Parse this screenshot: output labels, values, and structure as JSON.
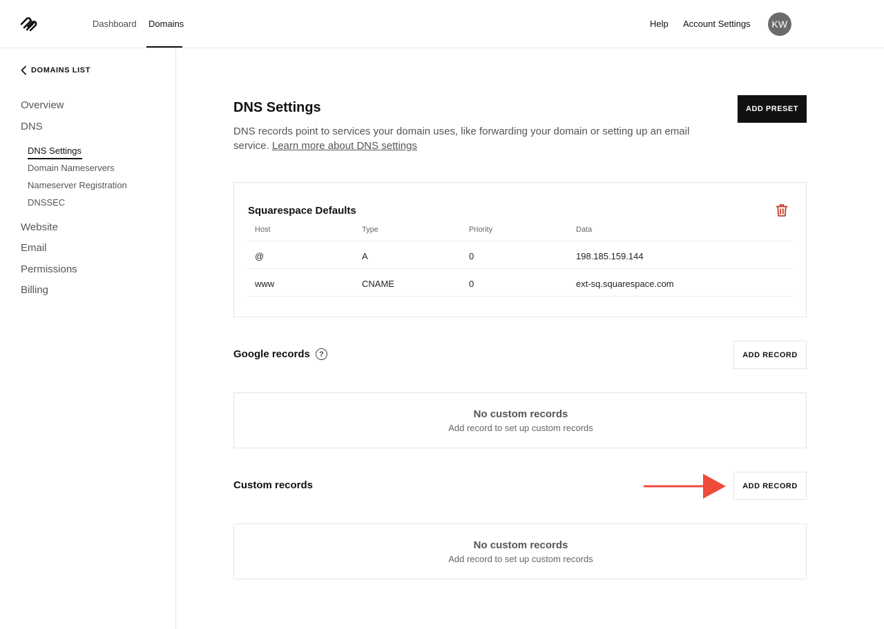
{
  "topbar": {
    "nav": [
      {
        "label": "Dashboard"
      },
      {
        "label": "Domains"
      }
    ],
    "help_label": "Help",
    "account_label": "Account Settings",
    "avatar_initials": "KW"
  },
  "sidebar": {
    "back_label": "DOMAINS LIST",
    "main": [
      {
        "label": "Overview"
      },
      {
        "label": "DNS"
      },
      {
        "label": "Website"
      },
      {
        "label": "Email"
      },
      {
        "label": "Permissions"
      },
      {
        "label": "Billing"
      }
    ],
    "sub": [
      {
        "label": "DNS Settings"
      },
      {
        "label": "Domain Nameservers"
      },
      {
        "label": "Nameserver Registration"
      },
      {
        "label": "DNSSEC"
      }
    ]
  },
  "main": {
    "title": "DNS Settings",
    "description": "DNS records point to services your domain uses, like forwarding your domain or setting up an email service.",
    "learn_more": "Learn more about DNS settings",
    "add_preset": "ADD PRESET",
    "defaults": {
      "title": "Squarespace Defaults",
      "columns": [
        "Host",
        "Type",
        "Priority",
        "Data"
      ],
      "rows": [
        [
          "@",
          "A",
          "0",
          "198.185.159.144"
        ],
        [
          "www",
          "CNAME",
          "0",
          "ext-sq.squarespace.com"
        ]
      ]
    },
    "google": {
      "title": "Google records",
      "help_glyph": "?",
      "add_label": "ADD RECORD",
      "empty_title": "No custom records",
      "empty_sub": "Add record to set up custom records"
    },
    "custom": {
      "title": "Custom records",
      "add_label": "ADD RECORD",
      "empty_title": "No custom records",
      "empty_sub": "Add record to set up custom records"
    }
  },
  "colors": {
    "accent_arrow": "#ee4b3b",
    "trash": "#c0392b",
    "dark_button": "#111111"
  },
  "icons": {
    "logo": "squarespace-logo",
    "back": "chevron-left-icon",
    "delete": "trash-icon",
    "help": "help-circle-icon",
    "pointer": "arrow-right-icon"
  }
}
